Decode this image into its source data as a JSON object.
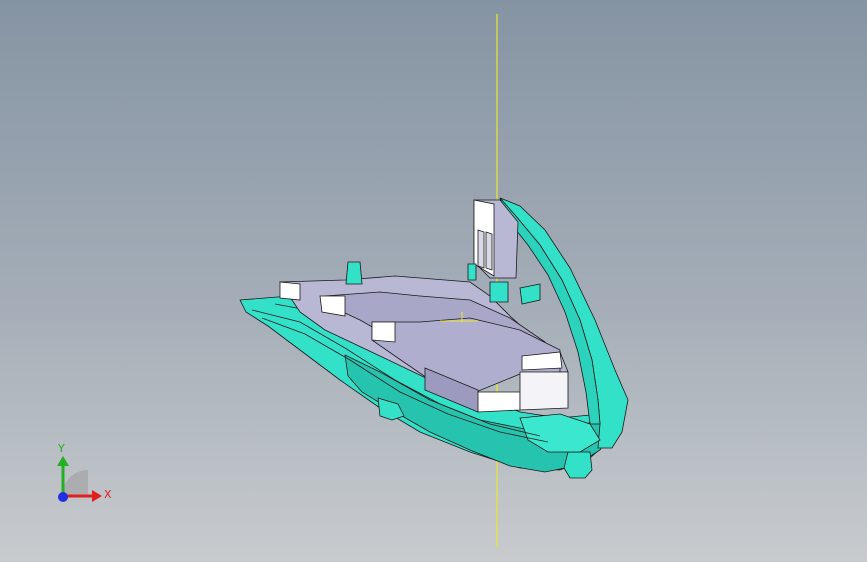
{
  "viewport": {
    "background_top": "#8594a3",
    "background_bottom": "#c8cbce"
  },
  "model": {
    "accent_color": "#33e0c8",
    "body_color": "#b8b7d4",
    "edge_color": "#1a1a1a",
    "axis_line_color": "#e8e830"
  },
  "triad": {
    "x_label": "X",
    "y_label": "Y",
    "x_color": "#e02020",
    "y_color": "#20b020",
    "z_color": "#2030e0"
  }
}
